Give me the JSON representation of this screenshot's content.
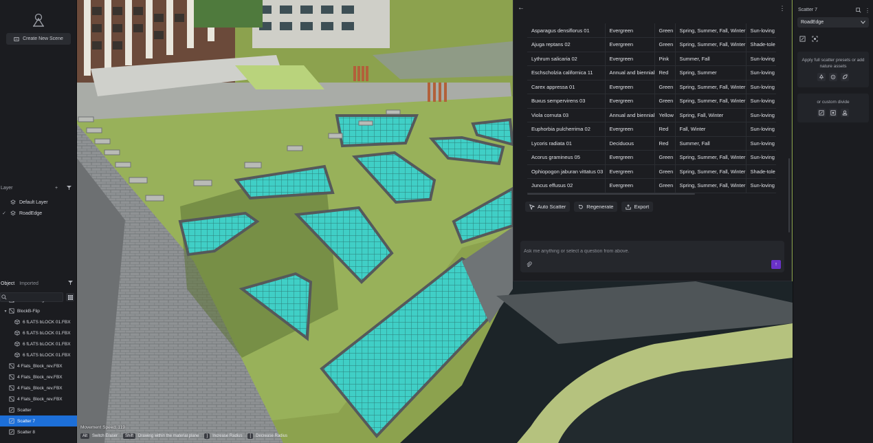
{
  "sidebar": {
    "create_label": "Create New Scene",
    "layer_header": "Layer",
    "layers": [
      {
        "label": "Default Layer",
        "checked": false
      },
      {
        "label": "RoadEdge",
        "checked": true
      }
    ],
    "object_tab": "Object",
    "imported_tab": "Imported",
    "search_placeholder": "",
    "tree": [
      {
        "label": "BlockB-Straight",
        "arrow": "▸",
        "indent": 1,
        "icon": "group-icon"
      },
      {
        "label": "BlockB-Flip",
        "arrow": "▾",
        "indent": 1,
        "icon": "group-icon"
      },
      {
        "label": "6 fLATS bLOCK 01.FBX",
        "arrow": "",
        "indent": 3,
        "icon": "mesh-icon"
      },
      {
        "label": "6 fLATS bLOCK 01.FBX",
        "arrow": "",
        "indent": 3,
        "icon": "mesh-icon"
      },
      {
        "label": "6 fLATS bLOCK 01.FBX",
        "arrow": "",
        "indent": 3,
        "icon": "mesh-icon"
      },
      {
        "label": "6 fLATS bLOCK 01.FBX",
        "arrow": "",
        "indent": 3,
        "icon": "mesh-icon"
      },
      {
        "label": "4 Flats_Block_rev.FBX",
        "arrow": "",
        "indent": 1,
        "icon": "group-icon"
      },
      {
        "label": "4 Flats_Block_rev.FBX",
        "arrow": "",
        "indent": 1,
        "icon": "group-icon"
      },
      {
        "label": "4 Flats_Block_rev.FBX",
        "arrow": "",
        "indent": 1,
        "icon": "group-icon"
      },
      {
        "label": "4 Flats_Block_rev.FBX",
        "arrow": "",
        "indent": 1,
        "icon": "group-icon"
      },
      {
        "label": "Scatter",
        "arrow": "",
        "indent": 1,
        "icon": "scatter-icon"
      },
      {
        "label": "Scatter 7",
        "arrow": "",
        "indent": 1,
        "icon": "scatter-icon",
        "selected": true
      },
      {
        "label": "Scatter 8",
        "arrow": "",
        "indent": 1,
        "icon": "scatter-icon"
      }
    ]
  },
  "viewport": {
    "speed_text": "Movement Speed: 119",
    "hints": [
      {
        "key": "Alt",
        "text": "Switch Eraser"
      },
      {
        "key": "Shift",
        "text": "Drawing within the material plane"
      },
      {
        "key": "]",
        "text": "Increase Radius"
      },
      {
        "key": "[",
        "text": "Decrease Radius"
      }
    ]
  },
  "panel": {
    "back_icon": "back-arrow-icon",
    "rows": [
      [
        "Asparagus densiflorus 01",
        "Evergreen",
        "Green",
        "Spring, Summer, Fall, Winter",
        "Sun-loving"
      ],
      [
        "Ajuga reptans 02",
        "Evergreen",
        "Green",
        "Spring, Summer, Fall, Winter",
        "Shade-tole"
      ],
      [
        "Lythrum salicaria 02",
        "Evergreen",
        "Pink",
        "Summer, Fall",
        "Sun-loving"
      ],
      [
        "Eschscholzia californica 11",
        "Annual and biennial",
        "Red",
        "Spring, Summer",
        "Sun-loving"
      ],
      [
        "Carex appressa 01",
        "Evergreen",
        "Green",
        "Spring, Summer, Fall, Winter",
        "Sun-loving"
      ],
      [
        "Buxus sempervirens 03",
        "Evergreen",
        "Green",
        "Spring, Summer, Fall, Winter",
        "Sun-loving"
      ],
      [
        "Viola cornuta 03",
        "Annual and biennial",
        "Yellow",
        "Spring, Fall, Winter",
        "Sun-loving"
      ],
      [
        "Euphorbia pulcherrima 02",
        "Evergreen",
        "Red",
        "Fall, Winter",
        "Sun-loving"
      ],
      [
        "Lycoris radiata 01",
        "Deciduous",
        "Red",
        "Summer, Fall",
        "Sun-loving"
      ],
      [
        "Acorus gramineus 05",
        "Evergreen",
        "Green",
        "Spring, Summer, Fall, Winter",
        "Sun-loving"
      ],
      [
        "Ophiopogon jaburan vittatus 03",
        "Evergreen",
        "Green",
        "Spring, Summer, Fall, Winter",
        "Shade-tole"
      ],
      [
        "Juncus effusus 02",
        "Evergreen",
        "Green",
        "Spring, Summer, Fall, Winter",
        "Sun-loving"
      ]
    ],
    "auto_scatter_label": "Auto Scatter",
    "regenerate_label": "Regenerate",
    "export_label": "Export",
    "chat_placeholder": "Ask me anything or select a question from above."
  },
  "right": {
    "title": "Scatter 7",
    "select_value": "RoadEdge",
    "preset_text": "Apply full scatter presets or add nature assets",
    "custom_text": "or custom divide"
  },
  "colors": {
    "accent": "#1d6fd8",
    "send": "#6a32c9",
    "grass": "#8ca24e",
    "pool": "#3fd3c8"
  }
}
